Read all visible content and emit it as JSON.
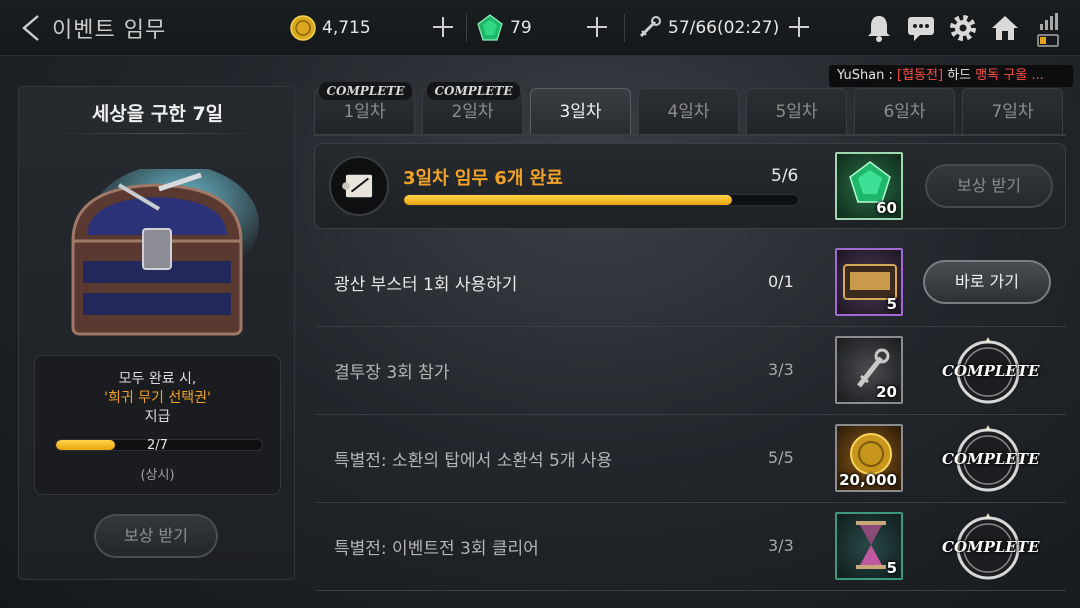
{
  "header": {
    "title": "이벤트 임무",
    "gold": "4,715",
    "gems": "79",
    "stamina": "57/66(02:27)"
  },
  "chat": {
    "user": "YuShan : ",
    "tag": "[협동전]",
    "text": " 하드 ",
    "highlight": "맹독 구울 ..."
  },
  "event": {
    "title": "세상을 구한 7일",
    "reward_line1": "모두 완료 시,",
    "reward_line2": "'희귀 무기 선택권'",
    "reward_line3": "지급",
    "progress_text": "2/7",
    "progress_fraction": 0.2857,
    "permanent": "(상시)",
    "claim_label": "보상 받기"
  },
  "tabs": [
    {
      "label": "1일차",
      "badge": "COMPLETE"
    },
    {
      "label": "2일차",
      "badge": "COMPLETE"
    },
    {
      "label": "3일차",
      "badge": ""
    },
    {
      "label": "4일차",
      "badge": ""
    },
    {
      "label": "5일차",
      "badge": ""
    },
    {
      "label": "6일차",
      "badge": ""
    },
    {
      "label": "7일차",
      "badge": ""
    }
  ],
  "summary": {
    "title": "3일차 임무 6개 완료",
    "count": "5/6",
    "fraction": 0.8333,
    "reward_qty": "60",
    "button": "보상 받기"
  },
  "missions": [
    {
      "name": "광산 부스터 1회 사용하기",
      "progress": "0/1",
      "reward_qty": "5",
      "action": "바로 가기",
      "complete": ""
    },
    {
      "name": "결투장 3회 참가",
      "progress": "3/3",
      "reward_qty": "20",
      "action": "",
      "complete": "COMPLETE"
    },
    {
      "name": "특별전: 소환의 탑에서 소환석 5개 사용",
      "progress": "5/5",
      "reward_qty": "20,000",
      "action": "",
      "complete": "COMPLETE"
    },
    {
      "name": "특별전: 이벤트전 3회 클리어",
      "progress": "3/3",
      "reward_qty": "5",
      "action": "",
      "complete": "COMPLETE"
    }
  ],
  "icons": {
    "back": "back-chevron-icon",
    "gold": "gold-coin-icon",
    "gem": "green-gem-icon",
    "stamina": "wrench-key-icon",
    "notification": "bell-icon",
    "chat": "chat-icon",
    "settings": "gear-icon",
    "home": "home-icon",
    "signal": "signal-battery-icon"
  },
  "colors": {
    "accent": "#f2a227",
    "progress": "#ffc928"
  }
}
